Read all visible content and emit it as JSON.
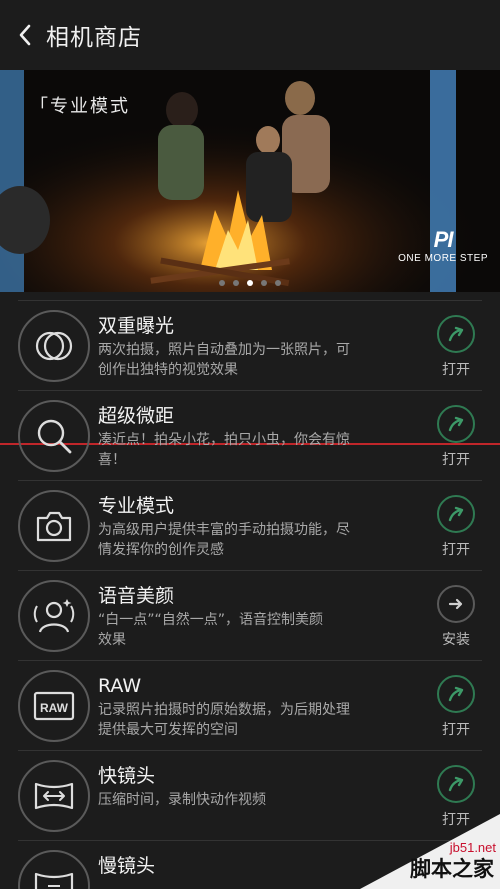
{
  "header": {
    "title": "相机商店"
  },
  "banner": {
    "tag": "「专业模式",
    "brand_mark": "PI",
    "brand_text": "ONE MORE STEP",
    "dots": 5,
    "active_dot": 3
  },
  "items": [
    {
      "name": "双重曝光",
      "desc1": "两次拍摄，照片自动叠加为一张照片，可",
      "desc2": "创作出独特的视觉效果",
      "icon": "double-exposure-icon",
      "action": "打开",
      "installed": true
    },
    {
      "name": "超级微距",
      "desc1": "凑近点！拍朵小花，拍只小虫，你会有惊",
      "desc2": "喜！",
      "icon": "magnifier-icon",
      "action": "打开",
      "installed": true
    },
    {
      "name": "专业模式",
      "desc1": "为高级用户提供丰富的手动拍摄功能，尽",
      "desc2": "情发挥你的创作灵感",
      "icon": "camera-icon",
      "action": "打开",
      "installed": true
    },
    {
      "name": "语音美颜",
      "desc1": "“白一点”“自然一点”，语音控制美颜",
      "desc2": "效果",
      "icon": "voice-beauty-icon",
      "action": "安装",
      "installed": false
    },
    {
      "name": "RAW",
      "desc1": "记录照片拍摄时的原始数据，为后期处理",
      "desc2": "提供最大可发挥的空间",
      "icon": "raw-icon",
      "action": "打开",
      "installed": true
    },
    {
      "name": "快镜头",
      "desc1": "压缩时间，录制快动作视频",
      "desc2": "",
      "icon": "timelapse-icon",
      "action": "打开",
      "installed": true
    },
    {
      "name": "慢镜头",
      "desc1": "",
      "desc2": "",
      "icon": "slowmo-icon",
      "action": "",
      "installed": true
    }
  ],
  "watermark": {
    "url": "jb51.net",
    "text": "脚本之家"
  },
  "colors": {
    "accent": "#2f7a52",
    "background": "#1c1c1c",
    "divider": "#333333",
    "alert_line": "#c0262a"
  }
}
